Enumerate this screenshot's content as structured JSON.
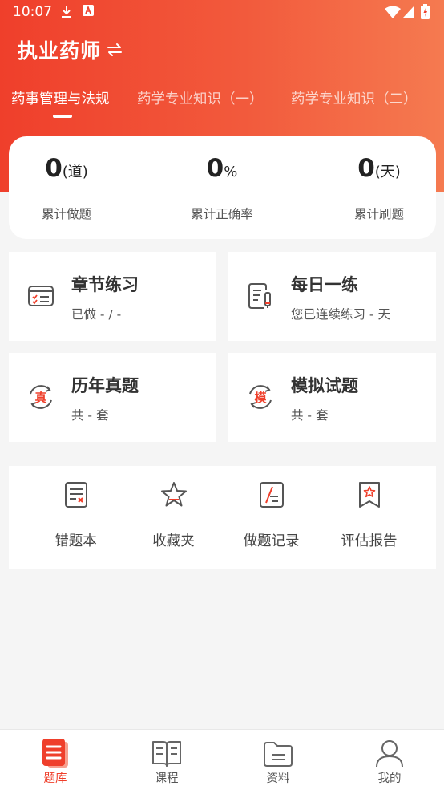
{
  "status_bar": {
    "time": "10:07"
  },
  "header": {
    "title": "执业药师",
    "tabs": [
      {
        "label": "药事管理与法规",
        "active": true
      },
      {
        "label": "药学专业知识（一）",
        "active": false
      },
      {
        "label": "药学专业知识（二）",
        "active": false
      }
    ]
  },
  "stats": [
    {
      "value": "0",
      "unit": "(道)",
      "label": "累计做题"
    },
    {
      "value": "0",
      "unit": "%",
      "label": "累计正确率"
    },
    {
      "value": "0",
      "unit": "(天)",
      "label": "累计刷题"
    }
  ],
  "tiles": [
    {
      "title": "章节练习",
      "subtitle": "已做 - / -",
      "icon": "chapter-practice-icon"
    },
    {
      "title": "每日一练",
      "subtitle": "您已连续练习 - 天",
      "icon": "daily-practice-icon"
    },
    {
      "title": "历年真题",
      "subtitle": "共 - 套",
      "icon": "past-exam-icon",
      "icon_char": "真"
    },
    {
      "title": "模拟试题",
      "subtitle": "共 - 套",
      "icon": "mock-exam-icon",
      "icon_char": "模"
    }
  ],
  "tools": [
    {
      "label": "错题本",
      "icon": "wrong-questions-icon"
    },
    {
      "label": "收藏夹",
      "icon": "favorites-star-icon"
    },
    {
      "label": "做题记录",
      "icon": "practice-record-icon"
    },
    {
      "label": "评估报告",
      "icon": "assessment-report-icon"
    }
  ],
  "bottom_nav": [
    {
      "label": "题库",
      "active": true,
      "icon": "question-bank-icon"
    },
    {
      "label": "课程",
      "active": false,
      "icon": "course-book-icon"
    },
    {
      "label": "资料",
      "active": false,
      "icon": "materials-folder-icon"
    },
    {
      "label": "我的",
      "active": false,
      "icon": "profile-user-icon"
    }
  ],
  "colors": {
    "accent": "#ef3f2b",
    "accent_light": "#f57a50",
    "background": "#f5f5f5"
  }
}
